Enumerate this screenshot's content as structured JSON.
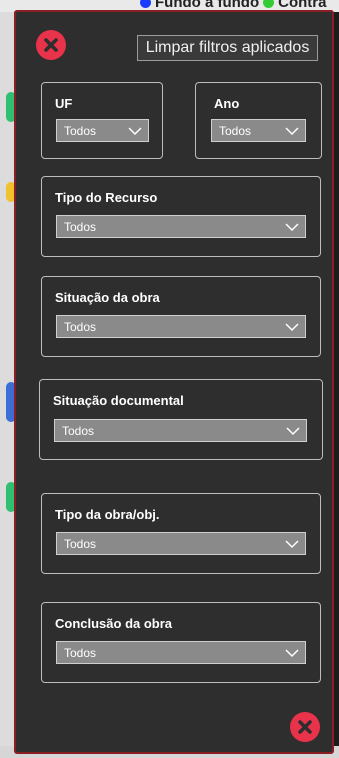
{
  "background": {
    "legend_items": [
      {
        "label": "Fundo a fundo",
        "color": "#1a3cff"
      },
      {
        "label": "Contra",
        "color": "#33cc33"
      }
    ]
  },
  "panel": {
    "clear_filters_label": "Limpar filtros aplicados",
    "accent_close_color": "#e8334a",
    "filters": [
      {
        "id": "uf",
        "label": "UF",
        "value": "Todos"
      },
      {
        "id": "ano",
        "label": "Ano",
        "value": "Todos"
      },
      {
        "id": "tipo-recurso",
        "label": "Tipo do Recurso",
        "value": "Todos"
      },
      {
        "id": "situacao-obra",
        "label": "Situação da obra",
        "value": "Todos"
      },
      {
        "id": "situacao-documental",
        "label": "Situação documental",
        "value": "Todos"
      },
      {
        "id": "tipo-obra",
        "label": "Tipo da obra/obj.",
        "value": "Todos"
      },
      {
        "id": "conclusao-obra",
        "label": "Conclusão da obra",
        "value": "Todos"
      }
    ]
  },
  "icons": {
    "close_top": "close-circle-icon",
    "close_bottom": "close-circle-icon",
    "chevron": "chevron-down-icon"
  }
}
